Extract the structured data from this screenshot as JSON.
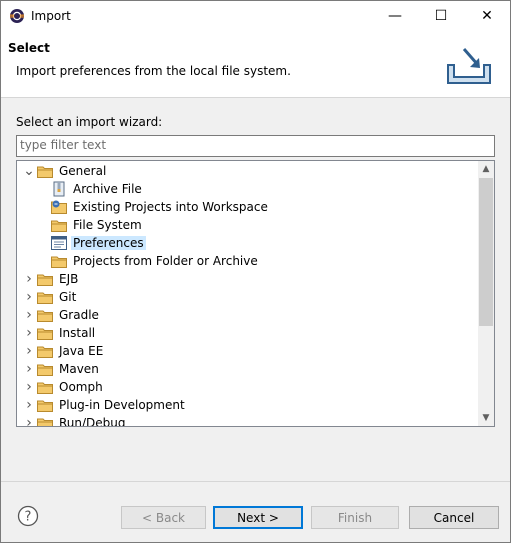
{
  "window": {
    "title": "Import",
    "minimize_glyph": "—",
    "maximize_glyph": "☐",
    "close_glyph": "✕"
  },
  "banner": {
    "title": "Select",
    "description": "Import preferences from the local file system."
  },
  "wizard": {
    "prompt": "Select an import wizard:",
    "filter_placeholder": "type filter text"
  },
  "tree": {
    "items": [
      {
        "label": "General",
        "level": 0,
        "expanded": true,
        "icon": "folder-icon"
      },
      {
        "label": "Archive File",
        "level": 1,
        "icon": "archive-file-icon"
      },
      {
        "label": "Existing Projects into Workspace",
        "level": 1,
        "icon": "projects-icon"
      },
      {
        "label": "File System",
        "level": 1,
        "icon": "folder-icon"
      },
      {
        "label": "Preferences",
        "level": 1,
        "icon": "preferences-icon",
        "selected": true
      },
      {
        "label": "Projects from Folder or Archive",
        "level": 1,
        "icon": "folder-icon"
      },
      {
        "label": "EJB",
        "level": 0,
        "expanded": false,
        "icon": "folder-icon"
      },
      {
        "label": "Git",
        "level": 0,
        "expanded": false,
        "icon": "folder-icon"
      },
      {
        "label": "Gradle",
        "level": 0,
        "expanded": false,
        "icon": "folder-icon"
      },
      {
        "label": "Install",
        "level": 0,
        "expanded": false,
        "icon": "folder-icon"
      },
      {
        "label": "Java EE",
        "level": 0,
        "expanded": false,
        "icon": "folder-icon"
      },
      {
        "label": "Maven",
        "level": 0,
        "expanded": false,
        "icon": "folder-icon"
      },
      {
        "label": "Oomph",
        "level": 0,
        "expanded": false,
        "icon": "folder-icon"
      },
      {
        "label": "Plug-in Development",
        "level": 0,
        "expanded": false,
        "icon": "folder-icon"
      },
      {
        "label": "Run/Debug",
        "level": 0,
        "expanded": false,
        "icon": "folder-icon"
      }
    ]
  },
  "buttons": {
    "back": "< Back",
    "next": "Next >",
    "finish": "Finish",
    "cancel": "Cancel"
  },
  "colors": {
    "selection": "#cce8ff",
    "folder": "#e8b04a",
    "accent": "#0078d7"
  }
}
